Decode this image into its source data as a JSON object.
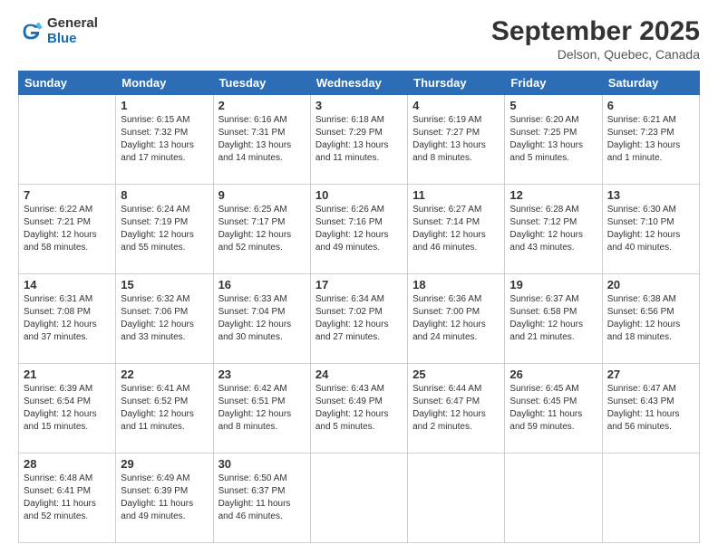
{
  "logo": {
    "general": "General",
    "blue": "Blue"
  },
  "header": {
    "title": "September 2025",
    "subtitle": "Delson, Quebec, Canada"
  },
  "days_of_week": [
    "Sunday",
    "Monday",
    "Tuesday",
    "Wednesday",
    "Thursday",
    "Friday",
    "Saturday"
  ],
  "weeks": [
    [
      {
        "day": "",
        "info": ""
      },
      {
        "day": "1",
        "info": "Sunrise: 6:15 AM\nSunset: 7:32 PM\nDaylight: 13 hours\nand 17 minutes."
      },
      {
        "day": "2",
        "info": "Sunrise: 6:16 AM\nSunset: 7:31 PM\nDaylight: 13 hours\nand 14 minutes."
      },
      {
        "day": "3",
        "info": "Sunrise: 6:18 AM\nSunset: 7:29 PM\nDaylight: 13 hours\nand 11 minutes."
      },
      {
        "day": "4",
        "info": "Sunrise: 6:19 AM\nSunset: 7:27 PM\nDaylight: 13 hours\nand 8 minutes."
      },
      {
        "day": "5",
        "info": "Sunrise: 6:20 AM\nSunset: 7:25 PM\nDaylight: 13 hours\nand 5 minutes."
      },
      {
        "day": "6",
        "info": "Sunrise: 6:21 AM\nSunset: 7:23 PM\nDaylight: 13 hours\nand 1 minute."
      }
    ],
    [
      {
        "day": "7",
        "info": "Sunrise: 6:22 AM\nSunset: 7:21 PM\nDaylight: 12 hours\nand 58 minutes."
      },
      {
        "day": "8",
        "info": "Sunrise: 6:24 AM\nSunset: 7:19 PM\nDaylight: 12 hours\nand 55 minutes."
      },
      {
        "day": "9",
        "info": "Sunrise: 6:25 AM\nSunset: 7:17 PM\nDaylight: 12 hours\nand 52 minutes."
      },
      {
        "day": "10",
        "info": "Sunrise: 6:26 AM\nSunset: 7:16 PM\nDaylight: 12 hours\nand 49 minutes."
      },
      {
        "day": "11",
        "info": "Sunrise: 6:27 AM\nSunset: 7:14 PM\nDaylight: 12 hours\nand 46 minutes."
      },
      {
        "day": "12",
        "info": "Sunrise: 6:28 AM\nSunset: 7:12 PM\nDaylight: 12 hours\nand 43 minutes."
      },
      {
        "day": "13",
        "info": "Sunrise: 6:30 AM\nSunset: 7:10 PM\nDaylight: 12 hours\nand 40 minutes."
      }
    ],
    [
      {
        "day": "14",
        "info": "Sunrise: 6:31 AM\nSunset: 7:08 PM\nDaylight: 12 hours\nand 37 minutes."
      },
      {
        "day": "15",
        "info": "Sunrise: 6:32 AM\nSunset: 7:06 PM\nDaylight: 12 hours\nand 33 minutes."
      },
      {
        "day": "16",
        "info": "Sunrise: 6:33 AM\nSunset: 7:04 PM\nDaylight: 12 hours\nand 30 minutes."
      },
      {
        "day": "17",
        "info": "Sunrise: 6:34 AM\nSunset: 7:02 PM\nDaylight: 12 hours\nand 27 minutes."
      },
      {
        "day": "18",
        "info": "Sunrise: 6:36 AM\nSunset: 7:00 PM\nDaylight: 12 hours\nand 24 minutes."
      },
      {
        "day": "19",
        "info": "Sunrise: 6:37 AM\nSunset: 6:58 PM\nDaylight: 12 hours\nand 21 minutes."
      },
      {
        "day": "20",
        "info": "Sunrise: 6:38 AM\nSunset: 6:56 PM\nDaylight: 12 hours\nand 18 minutes."
      }
    ],
    [
      {
        "day": "21",
        "info": "Sunrise: 6:39 AM\nSunset: 6:54 PM\nDaylight: 12 hours\nand 15 minutes."
      },
      {
        "day": "22",
        "info": "Sunrise: 6:41 AM\nSunset: 6:52 PM\nDaylight: 12 hours\nand 11 minutes."
      },
      {
        "day": "23",
        "info": "Sunrise: 6:42 AM\nSunset: 6:51 PM\nDaylight: 12 hours\nand 8 minutes."
      },
      {
        "day": "24",
        "info": "Sunrise: 6:43 AM\nSunset: 6:49 PM\nDaylight: 12 hours\nand 5 minutes."
      },
      {
        "day": "25",
        "info": "Sunrise: 6:44 AM\nSunset: 6:47 PM\nDaylight: 12 hours\nand 2 minutes."
      },
      {
        "day": "26",
        "info": "Sunrise: 6:45 AM\nSunset: 6:45 PM\nDaylight: 11 hours\nand 59 minutes."
      },
      {
        "day": "27",
        "info": "Sunrise: 6:47 AM\nSunset: 6:43 PM\nDaylight: 11 hours\nand 56 minutes."
      }
    ],
    [
      {
        "day": "28",
        "info": "Sunrise: 6:48 AM\nSunset: 6:41 PM\nDaylight: 11 hours\nand 52 minutes."
      },
      {
        "day": "29",
        "info": "Sunrise: 6:49 AM\nSunset: 6:39 PM\nDaylight: 11 hours\nand 49 minutes."
      },
      {
        "day": "30",
        "info": "Sunrise: 6:50 AM\nSunset: 6:37 PM\nDaylight: 11 hours\nand 46 minutes."
      },
      {
        "day": "",
        "info": ""
      },
      {
        "day": "",
        "info": ""
      },
      {
        "day": "",
        "info": ""
      },
      {
        "day": "",
        "info": ""
      }
    ]
  ]
}
